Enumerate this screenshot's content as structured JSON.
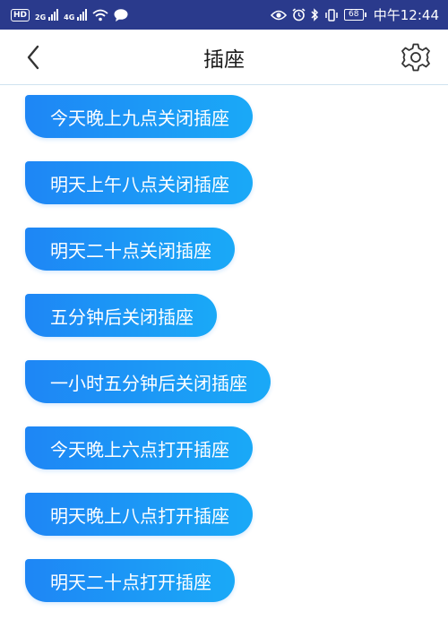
{
  "status_bar": {
    "hd": "HD",
    "net1": "2G",
    "net2": "4G",
    "battery": "68",
    "time": "中午12:44"
  },
  "header": {
    "title": "插座"
  },
  "commands": [
    "今天晚上九点关闭插座",
    "明天上午八点关闭插座",
    "明天二十点关闭插座",
    "五分钟后关闭插座",
    "一小时五分钟后关闭插座",
    "今天晚上六点打开插座",
    "明天晚上八点打开插座",
    "明天二十点打开插座"
  ],
  "colors": {
    "status_bar": "#2a3a8c",
    "chip_start": "#1e86f5",
    "chip_end": "#1aa9f7"
  }
}
